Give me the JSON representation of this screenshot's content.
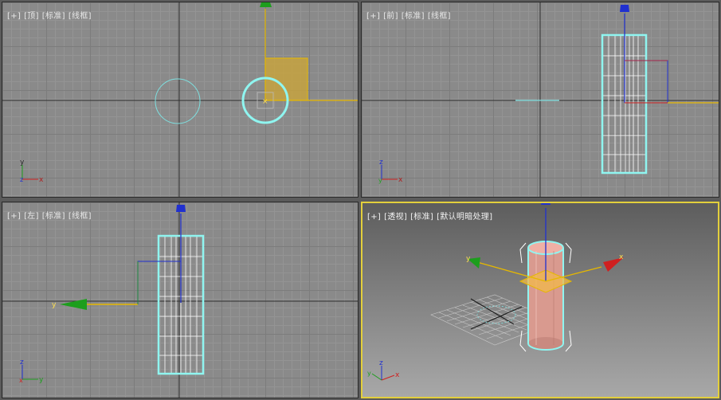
{
  "viewports": [
    {
      "id": "top",
      "labels": [
        "[+]",
        "[顶]",
        "[标准]",
        "[线框]"
      ]
    },
    {
      "id": "front",
      "labels": [
        "[+]",
        "[前]",
        "[标准]",
        "[线框]"
      ]
    },
    {
      "id": "left",
      "labels": [
        "[+]",
        "[左]",
        "[标准]",
        "[线框]"
      ]
    },
    {
      "id": "perspective",
      "labels": [
        "[+]",
        "[透视]",
        "[标准]",
        "[默认明暗处理]"
      ]
    }
  ],
  "axes": {
    "x": "x",
    "y": "y",
    "z": "z"
  },
  "colors": {
    "selection": "#8ff5f0",
    "axis_x": "#d02020",
    "axis_y": "#1d9e1d",
    "axis_z": "#2030d0",
    "gizmo_plane": "#e6b800",
    "active_border": "#e3cf3c"
  }
}
